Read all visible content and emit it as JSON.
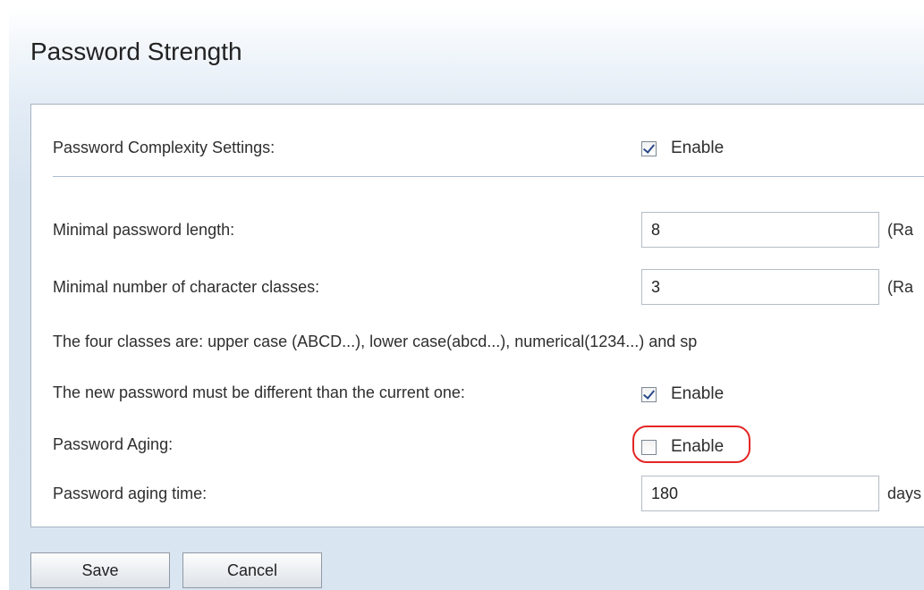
{
  "page": {
    "title": "Password Strength"
  },
  "settings": {
    "complexity": {
      "label": "Password Complexity Settings:",
      "checkbox_label": "Enable",
      "checked": true
    },
    "min_length": {
      "label": "Minimal password length:",
      "value": "8",
      "suffix": "(Ra"
    },
    "min_classes": {
      "label": "Minimal number of character classes:",
      "value": "3",
      "suffix": "(Ra"
    },
    "classes_note": "The four classes are: upper case (ABCD...), lower case(abcd...), numerical(1234...) and sp",
    "different_password": {
      "label": "The new password must be different than the current one:",
      "checkbox_label": "Enable",
      "checked": true
    },
    "aging": {
      "label": "Password Aging:",
      "checkbox_label": "Enable",
      "checked": false,
      "highlighted": true
    },
    "aging_time": {
      "label": "Password aging time:",
      "value": "180",
      "suffix": "days"
    }
  },
  "buttons": {
    "save": "Save",
    "cancel": "Cancel"
  },
  "colors": {
    "highlight": "#e32626",
    "panel_border": "#a6b3c2"
  }
}
